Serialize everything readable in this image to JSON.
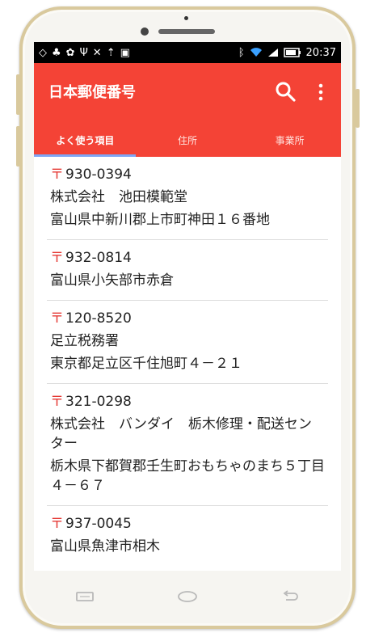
{
  "status": {
    "time": "20:37"
  },
  "app": {
    "title": "日本郵便番号"
  },
  "tabs": [
    {
      "label": "よく使う項目"
    },
    {
      "label": "住所"
    },
    {
      "label": "事業所"
    }
  ],
  "postal_symbol": "〒",
  "items": [
    {
      "code": "930-0394",
      "lines": [
        "株式会社　池田模範堂",
        "富山県中新川郡上市町神田１６番地"
      ]
    },
    {
      "code": "932-0814",
      "lines": [
        "富山県小矢部市赤倉"
      ]
    },
    {
      "code": "120-8520",
      "lines": [
        "足立税務署",
        "東京都足立区千住旭町４－２１"
      ]
    },
    {
      "code": "321-0298",
      "lines": [
        "株式会社　バンダイ　栃木修理・配送センター",
        "栃木県下都賀郡壬生町おもちゃのまち５丁目４－６７"
      ]
    },
    {
      "code": "937-0045",
      "lines": [
        "富山県魚津市相木"
      ]
    }
  ],
  "icons": [
    "search-icon",
    "more-vert-icon",
    "recent-apps-icon",
    "home-icon",
    "back-icon"
  ],
  "colors": {
    "appbar": "#f44336",
    "indicator": "#7ea6f5",
    "postal_mark": "#e53935"
  }
}
